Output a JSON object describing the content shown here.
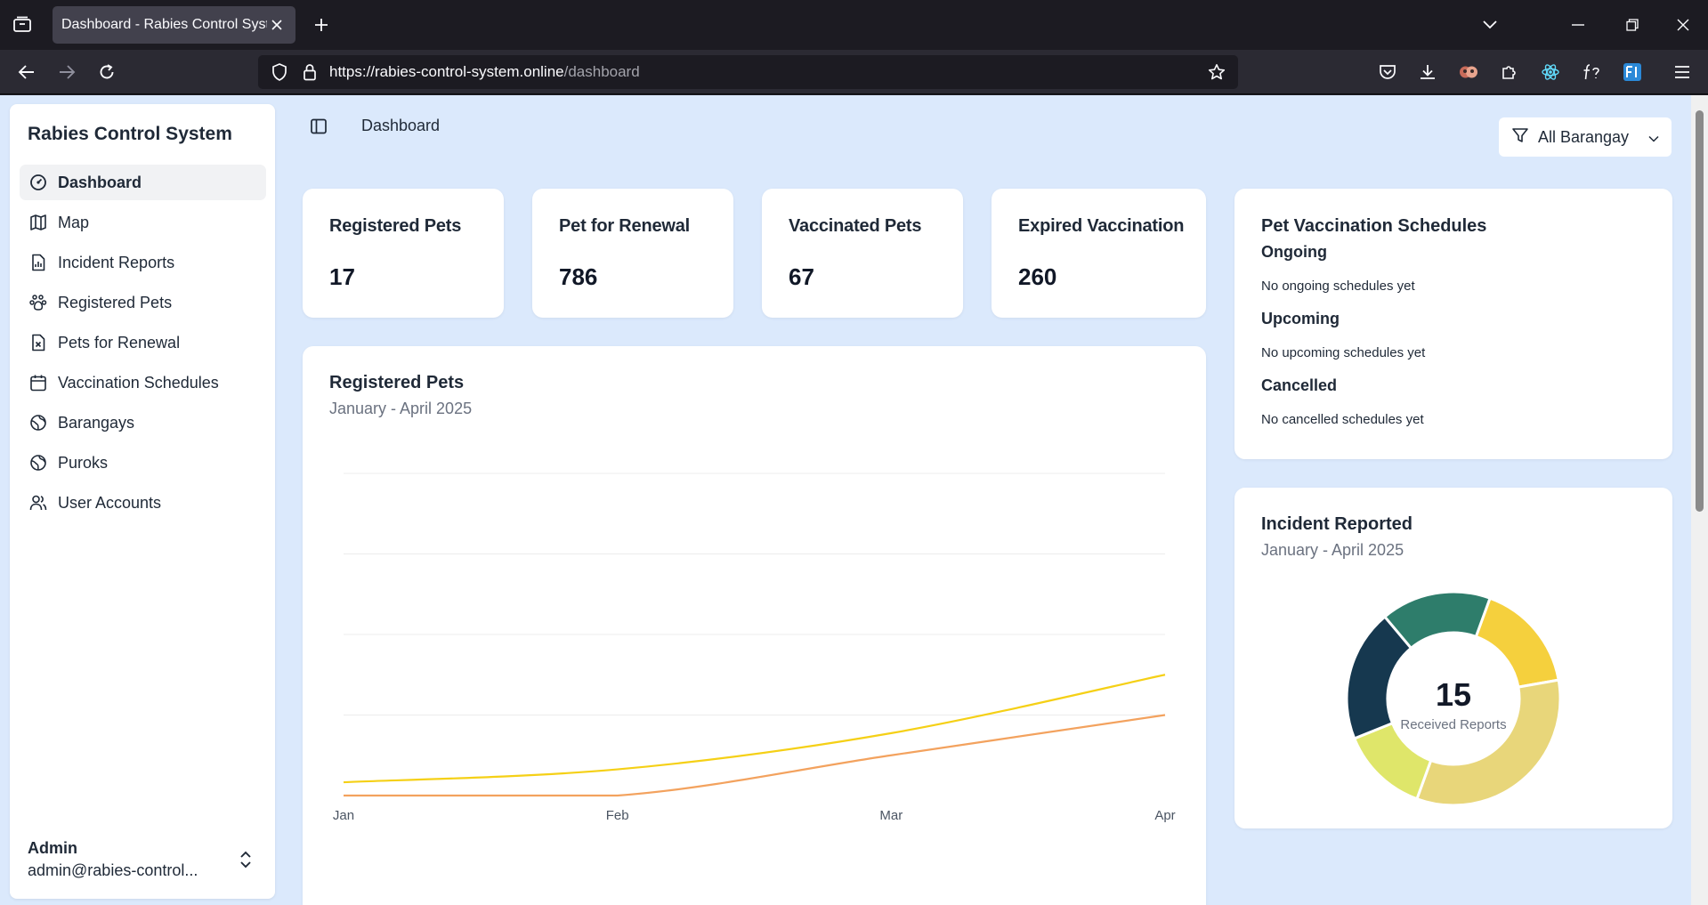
{
  "browser": {
    "tab_title": "Dashboard - Rabies Control System",
    "url_host": "https://rabies-control-system.online",
    "url_path": "/dashboard"
  },
  "sidebar": {
    "brand": "Rabies Control System",
    "items": [
      {
        "label": "Dashboard",
        "icon": "gauge-icon",
        "active": true
      },
      {
        "label": "Map",
        "icon": "map-icon"
      },
      {
        "label": "Incident Reports",
        "icon": "file-chart-icon"
      },
      {
        "label": "Registered Pets",
        "icon": "paw-icon"
      },
      {
        "label": "Pets for Renewal",
        "icon": "file-x-icon"
      },
      {
        "label": "Vaccination Schedules",
        "icon": "calendar-icon"
      },
      {
        "label": "Barangays",
        "icon": "globe-icon"
      },
      {
        "label": "Puroks",
        "icon": "globe-icon"
      },
      {
        "label": "User Accounts",
        "icon": "users-icon"
      }
    ],
    "user": {
      "name": "Admin",
      "email": "admin@rabies-control..."
    }
  },
  "header": {
    "title": "Dashboard",
    "filter_label": "All Barangay"
  },
  "stats": [
    {
      "title": "Registered Pets",
      "value": "17"
    },
    {
      "title": "Pet for Renewal",
      "value": "786"
    },
    {
      "title": "Vaccinated Pets",
      "value": "67"
    },
    {
      "title": "Expired Vaccination",
      "value": "260"
    }
  ],
  "schedules": {
    "title": "Pet Vaccination Schedules",
    "sections": [
      {
        "heading": "Ongoing",
        "empty": "No ongoing schedules yet"
      },
      {
        "heading": "Upcoming",
        "empty": "No upcoming schedules yet"
      },
      {
        "heading": "Cancelled",
        "empty": "No cancelled schedules yet"
      }
    ]
  },
  "registered_chart": {
    "title": "Registered Pets",
    "subtitle": "January - April 2025"
  },
  "incident_chart": {
    "title": "Incident Reported",
    "subtitle": "January - April 2025",
    "center_value": "15",
    "center_label": "Received Reports"
  },
  "chart_data": [
    {
      "type": "line",
      "title": "Registered Pets",
      "subtitle": "January - April 2025",
      "categories": [
        "Jan",
        "Feb",
        "Mar",
        "Apr"
      ],
      "ylim": [
        0,
        8
      ],
      "grid": true,
      "series": [
        {
          "color": "#f5d016",
          "values": [
            0.33,
            0.65,
            1.55,
            3.0
          ]
        },
        {
          "color": "#f3a25e",
          "values": [
            0,
            0,
            1.0,
            2.0
          ]
        }
      ]
    },
    {
      "type": "pie",
      "title": "Incident Reported",
      "subtitle": "January - April 2025",
      "total": 15,
      "slices": [
        {
          "value": 2.5,
          "color": "#f5d03d"
        },
        {
          "value": 5,
          "color": "#e8d67a"
        },
        {
          "value": 2,
          "color": "#dfe66a"
        },
        {
          "value": 3,
          "color": "#16384f"
        },
        {
          "value": 2.5,
          "color": "#2e7d6b"
        }
      ]
    }
  ]
}
